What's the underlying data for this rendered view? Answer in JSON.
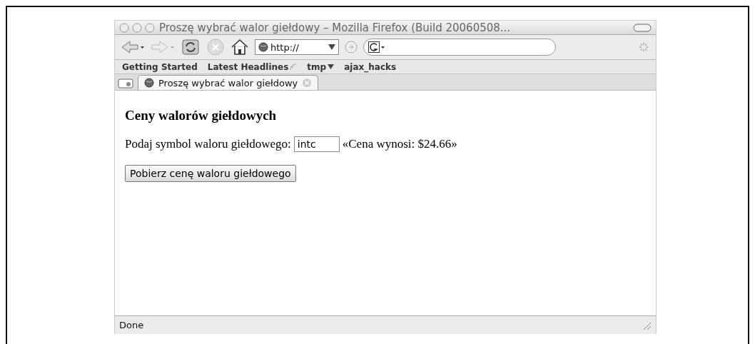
{
  "window": {
    "title": "Proszę wybrać walor giełdowy – Mozilla Firefox (Build 20060508..."
  },
  "toolbar": {
    "url": {
      "value": "http://"
    }
  },
  "bookmarks": [
    {
      "label": "Getting Started",
      "kind": "link"
    },
    {
      "label": "Latest Headlines",
      "kind": "feed"
    },
    {
      "label": "tmp",
      "kind": "folder"
    },
    {
      "label": "ajax_hacks",
      "kind": "link"
    }
  ],
  "tabs": [
    {
      "label": "Proszę wybrać walor giełdowy",
      "selected": true
    }
  ],
  "page": {
    "heading": "Ceny walorów giełdowych",
    "prompt": "Podaj symbol waloru giełdowego:",
    "symbol_field": {
      "value": "intc"
    },
    "result": "«Cena wynosi: $24.66»",
    "button": "Pobierz cenę waloru giełdowego"
  },
  "status_bar": {
    "text": "Done"
  }
}
